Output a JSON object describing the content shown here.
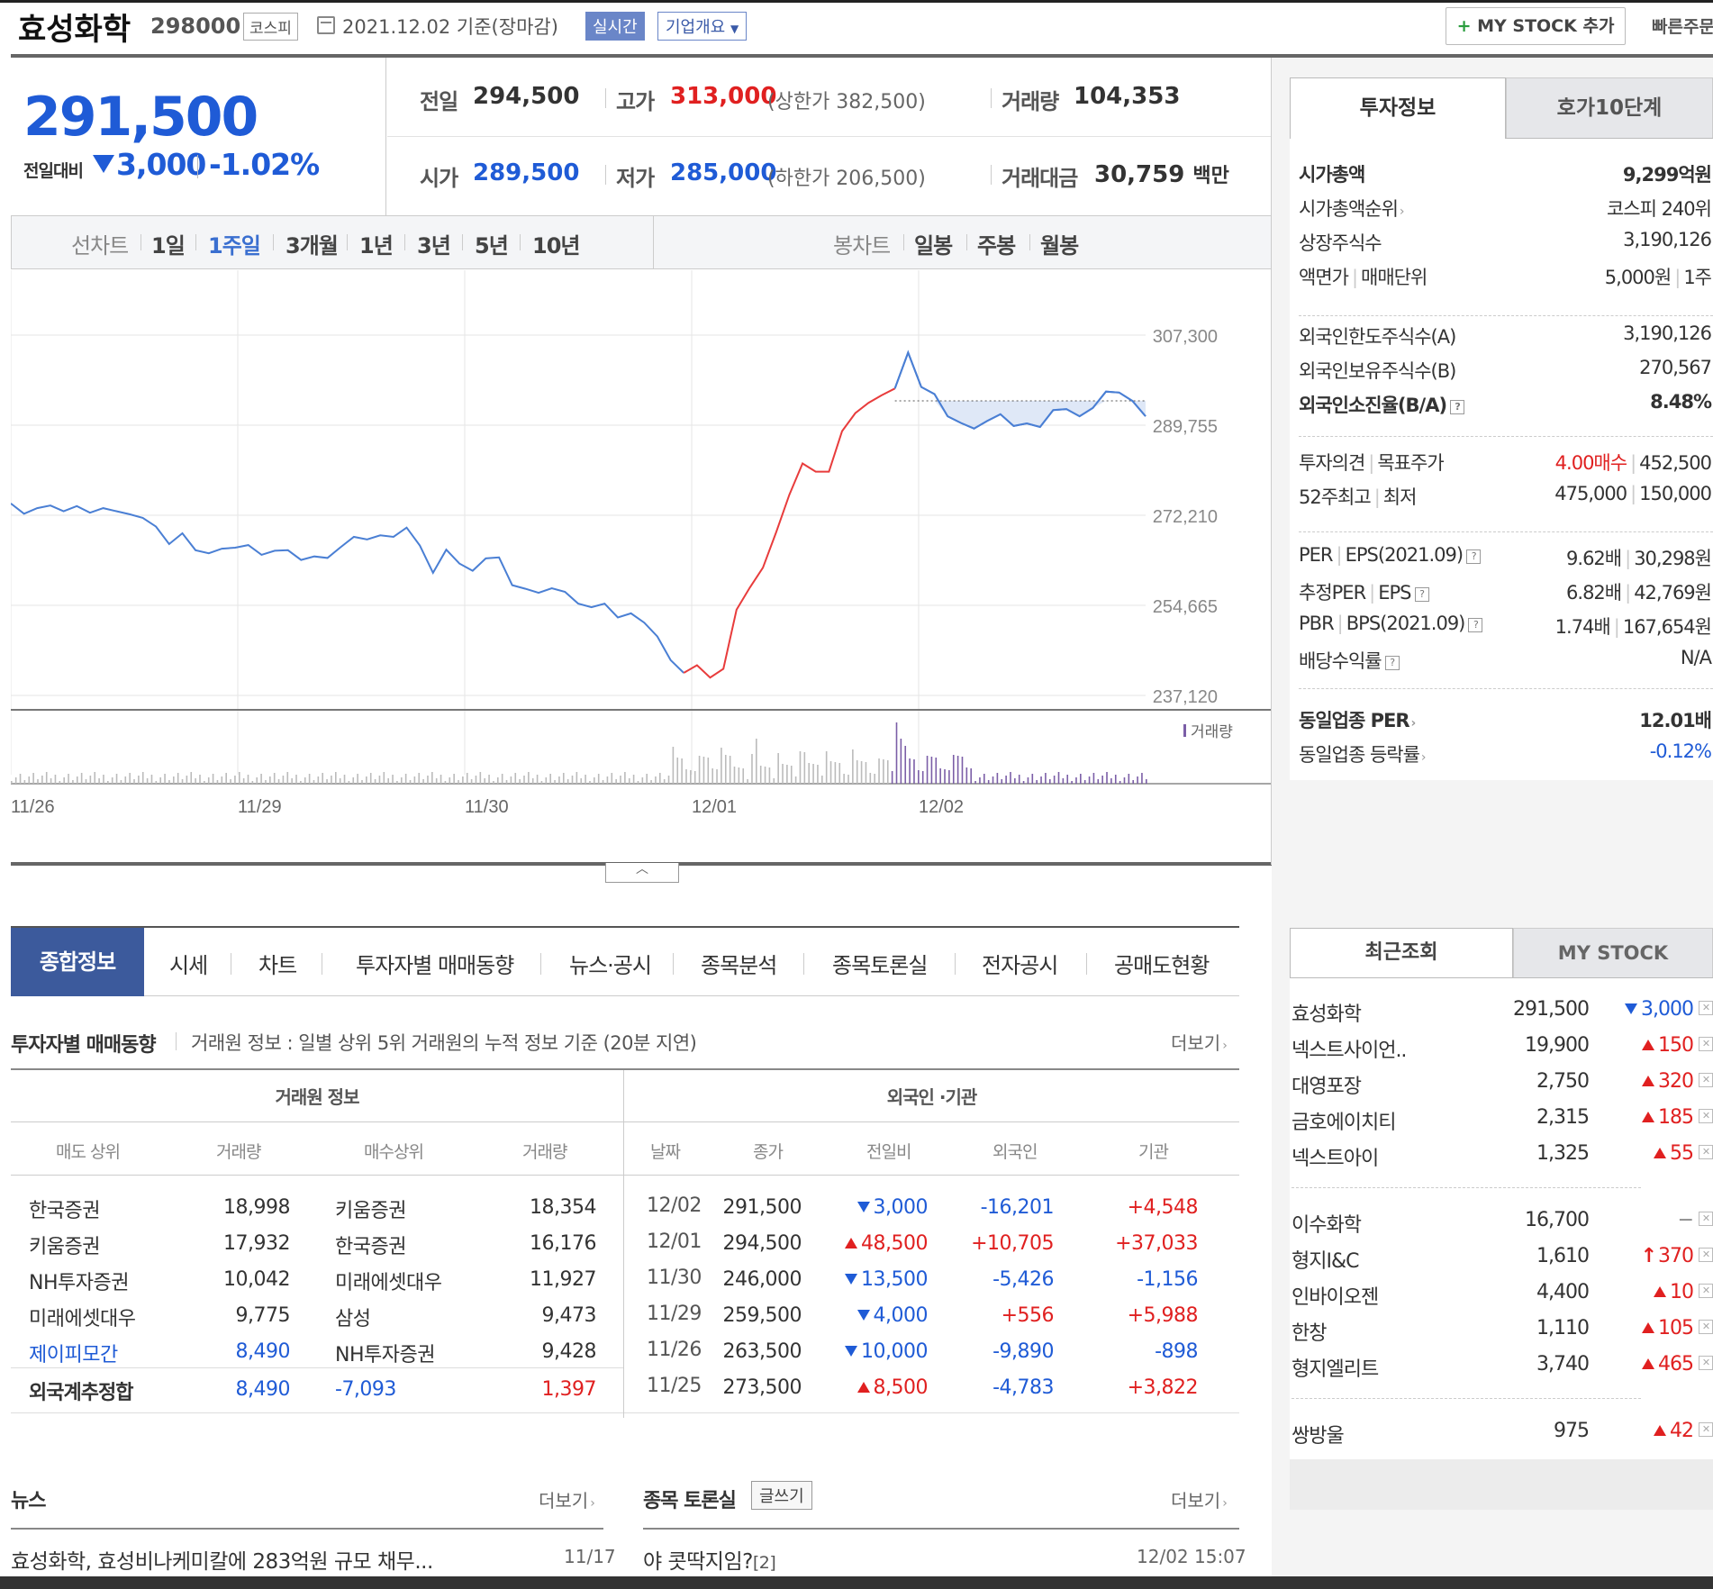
{
  "header": {
    "stock_name": "효성화학",
    "stock_code": "298000",
    "market": "코스피",
    "date": "2021.12.02 기준(장마감)",
    "realtime_btn": "실시간",
    "company_btn": "기업개요",
    "mystock_btn": "MY STOCK 추가",
    "quick_order": "빠른주문"
  },
  "price": {
    "current": "291,500",
    "change_label": "전일대비",
    "change": "3,000",
    "change_pct": "-1.02%",
    "prev_label": "전일",
    "prev": "294,500",
    "high_label": "고가",
    "high": "313,000",
    "upper_limit": "(상한가 382,500)",
    "volume_label": "거래량",
    "volume": "104,353",
    "open_label": "시가",
    "open": "289,500",
    "low_label": "저가",
    "low": "285,000",
    "lower_limit": "(하한가 206,500)",
    "amount_label": "거래대금",
    "amount": "30,759",
    "amount_unit": "백만"
  },
  "period_bar": {
    "line_label": "선차트",
    "periods": [
      "1일",
      "1주일",
      "3개월",
      "1년",
      "3년",
      "5년",
      "10년"
    ],
    "active_period": "1주일",
    "candle_label": "봉차트",
    "candles": [
      "일봉",
      "주봉",
      "월봉"
    ]
  },
  "chart_data": {
    "type": "line",
    "title": "",
    "x_labels": [
      "11/26",
      "11/29",
      "11/30",
      "12/01",
      "12/02"
    ],
    "y_ticks": [
      307300,
      289755,
      272210,
      254665,
      237120
    ],
    "y_tick_labels": [
      "307,300",
      "289,755",
      "272,210",
      "254,665",
      "237,120"
    ],
    "ylim": [
      237120,
      307300
    ],
    "grid": true,
    "prev_close": 294500,
    "price_series": {
      "name": "",
      "values": [
        274500,
        272500,
        273600,
        274100,
        273000,
        274000,
        272700,
        273600,
        273000,
        272400,
        271700,
        270000,
        266600,
        268700,
        265400,
        264800,
        265700,
        265900,
        266400,
        264500,
        265300,
        265400,
        263500,
        264200,
        263900,
        266000,
        268000,
        267500,
        268300,
        268000,
        269800,
        266300,
        261000,
        265500,
        262800,
        261400,
        263800,
        264000,
        258600,
        257900,
        257100,
        258000,
        257300,
        255000,
        254300,
        255000,
        252300,
        253100,
        251300,
        248600,
        244000,
        241500,
        243000,
        240600,
        242300,
        253800,
        258100,
        262000,
        268900,
        276200,
        282300,
        280700,
        280700,
        288600,
        292100,
        294100,
        295600,
        296900,
        303900,
        297200,
        295800,
        291500,
        290200,
        289100,
        290600,
        291900,
        289600,
        290100,
        289400,
        292700,
        292900,
        291500,
        293100,
        296300,
        296100,
        294500,
        291500
      ]
    },
    "volume_label": "거래량"
  },
  "invest_info": {
    "tab_active": "투자정보",
    "tab_other": "호가10단계",
    "rows1": [
      {
        "label": "시가총액",
        "value": "9,299억원"
      },
      {
        "label": "시가총액순위",
        "value": "코스피 240위"
      },
      {
        "label": "상장주식수",
        "value": "3,190,126"
      },
      {
        "label": "액면가",
        "label2": "매매단위",
        "value": "5,000원",
        "value2": "1주"
      }
    ],
    "rows2": [
      {
        "label": "외국인한도주식수(A)",
        "value": "3,190,126"
      },
      {
        "label": "외국인보유주식수(B)",
        "value": "270,567"
      },
      {
        "label": "외국인소진율(B/A)",
        "value": "8.48%"
      }
    ],
    "rows3": [
      {
        "label": "투자의견",
        "label2": "목표주가",
        "value": "4.00매수",
        "value2": "452,500"
      },
      {
        "label": "52주최고",
        "label2": "최저",
        "value": "475,000",
        "value2": "150,000"
      }
    ],
    "rows4": [
      {
        "label": "PER",
        "label2": "EPS(2021.09)",
        "value": "9.62배",
        "value2": "30,298원"
      },
      {
        "label": "추정PER",
        "label2": "EPS",
        "value": "6.82배",
        "value2": "42,769원"
      },
      {
        "label": "PBR",
        "label2": "BPS(2021.09)",
        "value": "1.74배",
        "value2": "167,654원"
      },
      {
        "label": "배당수익률",
        "value": "N/A"
      }
    ],
    "rows5": [
      {
        "label": "동일업종 PER",
        "value": "12.01배"
      },
      {
        "label": "동일업종 등락률",
        "value": "-0.12%"
      }
    ]
  },
  "recent": {
    "tab_active": "최근조회",
    "tab_other": "MY STOCK",
    "group1": [
      {
        "name": "효성화학",
        "price": "291,500",
        "dir": "down",
        "chg": "3,000"
      },
      {
        "name": "넥스트사이언..",
        "price": "19,900",
        "dir": "up",
        "chg": "150"
      },
      {
        "name": "대영포장",
        "price": "2,750",
        "dir": "up",
        "chg": "320"
      },
      {
        "name": "금호에이치티",
        "price": "2,315",
        "dir": "up",
        "chg": "185"
      },
      {
        "name": "넥스트아이",
        "price": "1,325",
        "dir": "up",
        "chg": "55"
      }
    ],
    "group2": [
      {
        "name": "이수화학",
        "price": "16,700",
        "dir": "flat",
        "chg": "−"
      },
      {
        "name": "형지I&C",
        "price": "1,610",
        "dir": "upper",
        "chg": "370"
      },
      {
        "name": "인바이오젠",
        "price": "4,400",
        "dir": "up",
        "chg": "10"
      },
      {
        "name": "한창",
        "price": "1,110",
        "dir": "up",
        "chg": "105"
      },
      {
        "name": "형지엘리트",
        "price": "3,740",
        "dir": "up",
        "chg": "465"
      }
    ],
    "group3": [
      {
        "name": "쌍방울",
        "price": "975",
        "dir": "up",
        "chg": "42"
      }
    ]
  },
  "main_tabs": [
    "종합정보",
    "시세",
    "차트",
    "투자자별 매매동향",
    "뉴스·공시",
    "종목분석",
    "종목토론실",
    "전자공시",
    "공매도현황"
  ],
  "investor": {
    "title": "투자자별 매매동향",
    "desc": "거래원 정보 : 일별 상위 5위 거래원의 누적 정보 기준 (20분 지연)",
    "more": "더보기",
    "broker_header": "거래원 정보",
    "foreign_header": "외국인 ·기관",
    "broker_cols": [
      "매도 상위",
      "거래량",
      "매수상위",
      "거래량"
    ],
    "foreign_cols": [
      "날짜",
      "종가",
      "전일비",
      "외국인",
      "기관"
    ],
    "broker_rows": [
      [
        "한국증권",
        "18,998",
        "키움증권",
        "18,354"
      ],
      [
        "키움증권",
        "17,932",
        "한국증권",
        "16,176"
      ],
      [
        "NH투자증권",
        "10,042",
        "미래에셋대우",
        "11,927"
      ],
      [
        "미래에셋대우",
        "9,775",
        "삼성",
        "9,473"
      ],
      [
        "제이피모간",
        "8,490",
        "NH투자증권",
        "9,428"
      ]
    ],
    "foreign_total": [
      "외국계추정합",
      "8,490",
      "-7,093",
      "1,397"
    ],
    "foreign_rows": [
      {
        "date": "12/02",
        "close": "291,500",
        "dir": "down",
        "chg": "3,000",
        "foreign": "-16,201",
        "inst": "+4,548"
      },
      {
        "date": "12/01",
        "close": "294,500",
        "dir": "up",
        "chg": "48,500",
        "foreign": "+10,705",
        "inst": "+37,033"
      },
      {
        "date": "11/30",
        "close": "246,000",
        "dir": "down",
        "chg": "13,500",
        "foreign": "-5,426",
        "inst": "-1,156"
      },
      {
        "date": "11/29",
        "close": "259,500",
        "dir": "down",
        "chg": "4,000",
        "foreign": "+556",
        "inst": "+5,988"
      },
      {
        "date": "11/26",
        "close": "263,500",
        "dir": "down",
        "chg": "10,000",
        "foreign": "-9,890",
        "inst": "-898"
      },
      {
        "date": "11/25",
        "close": "273,500",
        "dir": "up",
        "chg": "8,500",
        "foreign": "-4,783",
        "inst": "+3,822"
      }
    ]
  },
  "news": {
    "title": "뉴스",
    "more": "더보기",
    "item_title": "효성화학, 효성비나케미칼에 283억원 규모 채무...",
    "item_date": "11/17"
  },
  "forum": {
    "title": "종목 토론실",
    "write": "글쓰기",
    "more": "더보기",
    "item_title": "야 콧딱지임?",
    "item_count": "[2]",
    "item_date": "12/02 15:07"
  },
  "colors": {
    "up": "#e02020",
    "down": "#1f5bd6",
    "accent": "#3c5a9c"
  }
}
